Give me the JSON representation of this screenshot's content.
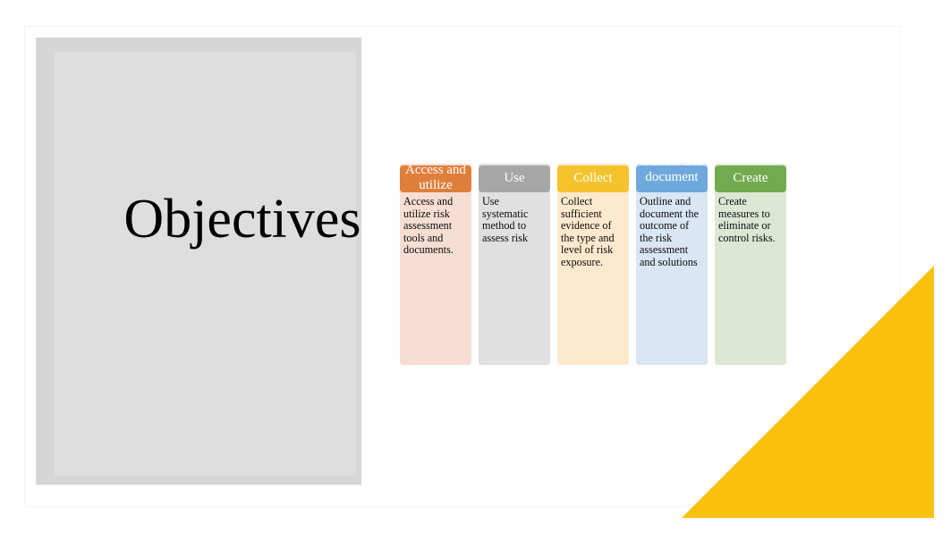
{
  "slide": {
    "title": "Objectives",
    "background_color": "#ffffff",
    "panel_color": "#dedede",
    "accent_color": "#FBC108"
  },
  "decoration": {
    "corner_triangle_name": "yellow-corner-triangle",
    "corner_triangle_color": "#FBC108",
    "frame_name": "slide-frame"
  },
  "cards": [
    {
      "header": "Access and utilize",
      "body": "Access and utilize risk assessment tools and documents.",
      "header_color": "#E07E3C",
      "body_color": "#f7ded3"
    },
    {
      "header": "Use",
      "body": "Use systematic method to assess risk",
      "header_color": "#a6a6a6",
      "body_color": "#e0e0e0"
    },
    {
      "header": "Collect",
      "body": "Collect sufficient evidence of the type and level of risk exposure.",
      "header_color": "#F4C32C",
      "body_color": "#fde9cd"
    },
    {
      "header": "Outline and document",
      "body": "Outline and document the outcome of the risk assessment and solutions",
      "header_color": "#6FA8DC",
      "body_color": "#d8e6f5"
    },
    {
      "header": "Create",
      "body": "Create measures to eliminate or control risks.",
      "header_color": "#73A94F",
      "body_color": "#dce8d4"
    }
  ]
}
